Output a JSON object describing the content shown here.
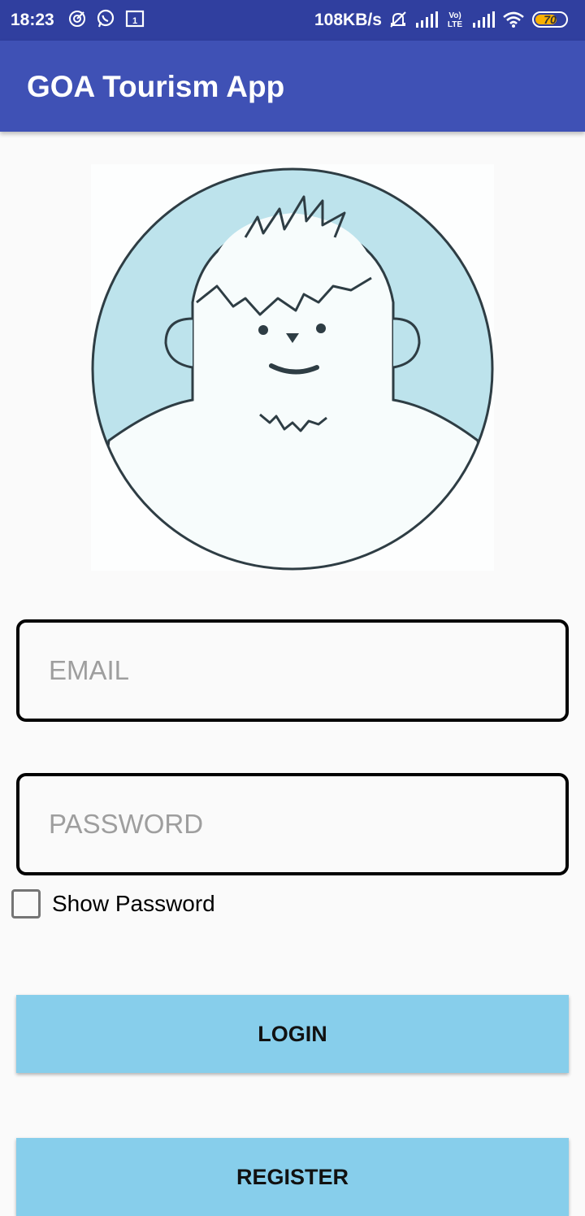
{
  "status_bar": {
    "time": "18:23",
    "speed": "108KB/s",
    "battery": "70",
    "network_label": "Vo) LTE"
  },
  "app_bar": {
    "title": "GOA Tourism App"
  },
  "avatar": {
    "icon": "yeti-avatar-image"
  },
  "form": {
    "email_placeholder": "EMAIL",
    "password_placeholder": "PASSWORD",
    "show_password_label": "Show Password",
    "show_password_checked": false
  },
  "buttons": {
    "login": "LOGIN",
    "register": "REGISTER"
  },
  "colors": {
    "status_bar": "#303f9f",
    "app_bar": "#3f51b5",
    "button": "#87ceeb",
    "avatar_bg": "#bde3ec"
  }
}
